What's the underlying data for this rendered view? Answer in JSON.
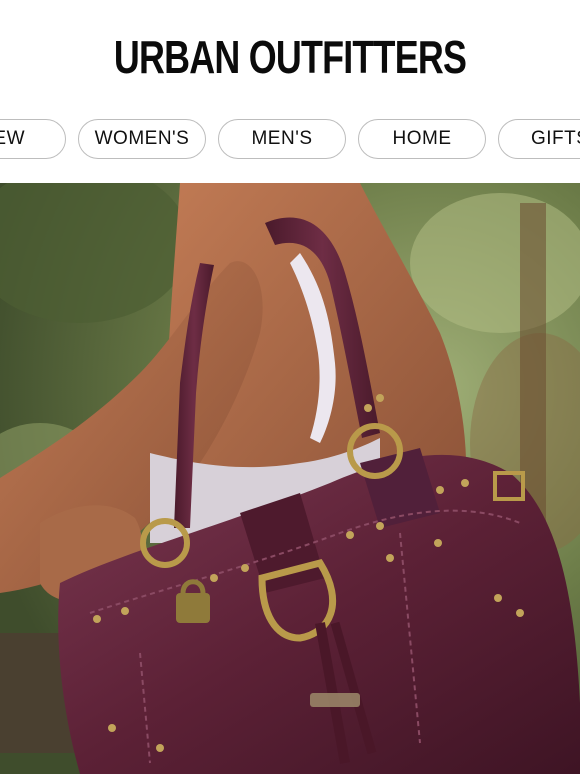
{
  "brand": {
    "logo_text": "URBAN OUTFITTERS"
  },
  "nav": {
    "items": [
      {
        "label": "NEW",
        "visible_text": "EW"
      },
      {
        "label": "WOMEN'S",
        "visible_text": "WOMEN'S"
      },
      {
        "label": "MEN'S",
        "visible_text": "MEN'S"
      },
      {
        "label": "HOME",
        "visible_text": "HOME"
      },
      {
        "label": "GIFTS",
        "visible_text": "GIFTS"
      }
    ]
  },
  "hero": {
    "image_subject": "purple leather shoulder bag on model outdoors",
    "colors": {
      "bag": "#5e2538",
      "skin": "#a8694a",
      "foliage": "#6d7d4a",
      "hardware": "#b99a4a"
    }
  }
}
